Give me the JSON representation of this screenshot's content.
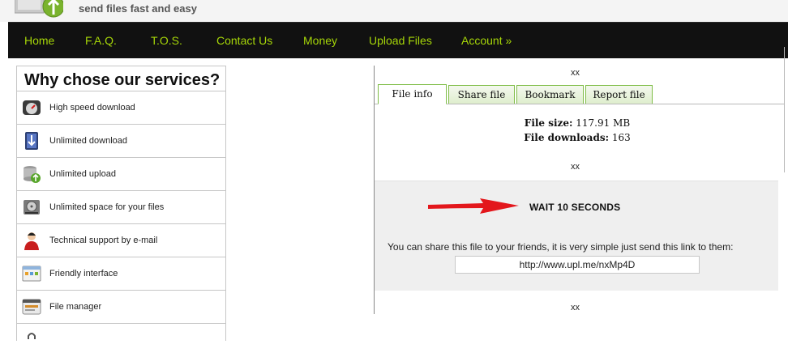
{
  "header": {
    "tagline": "send files fast and easy"
  },
  "nav": {
    "items": [
      "Home",
      "F.A.Q.",
      "T.O.S.",
      "Contact Us",
      "Money",
      "Upload Files",
      "Account »"
    ]
  },
  "features": {
    "title": "Why chose our services?",
    "items": [
      {
        "label": "High speed download",
        "icon": "speedometer-icon"
      },
      {
        "label": "Unlimited download",
        "icon": "download-arrow-icon"
      },
      {
        "label": "Unlimited upload",
        "icon": "upload-database-icon"
      },
      {
        "label": "Unlimited space for your files",
        "icon": "hard-drive-icon"
      },
      {
        "label": "Technical support by e-mail",
        "icon": "support-person-icon"
      },
      {
        "label": "Friendly interface",
        "icon": "window-interface-icon"
      },
      {
        "label": "File manager",
        "icon": "file-manager-icon"
      }
    ]
  },
  "file_panel": {
    "ad_top": "xx",
    "ad_mid": "xx",
    "ad_bottom": "xx",
    "tabs": [
      {
        "label": "File info",
        "active": true
      },
      {
        "label": "Share file",
        "active": false
      },
      {
        "label": "Bookmark",
        "active": false
      },
      {
        "label": "Report file",
        "active": false
      }
    ],
    "size_label": "File size:",
    "size_value": "117.91 MB",
    "downloads_label": "File downloads:",
    "downloads_value": "163",
    "wait_text": "WAIT 10 SECONDS",
    "share_text": "You can share this file to your friends, it is very simple just send this link to them:",
    "share_link": "http://www.upl.me/nxMp4D"
  },
  "colors": {
    "nav_background": "#111111",
    "nav_link": "#a6d608",
    "tab_border": "#7fbd47",
    "arrow": "#e3171c"
  }
}
